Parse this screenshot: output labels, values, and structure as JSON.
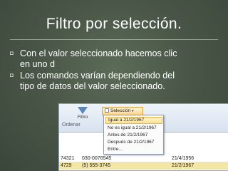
{
  "slide": {
    "title": "Filtro por selección.",
    "bullet_glyph": "◘",
    "bullets": [
      {
        "line1": "Con el valor seleccionado  hacemos clic",
        "line2": "en uno d"
      },
      {
        "line1": "Los comandos varían dependiendo del",
        "line2": "tipo de datos del valor seleccionado."
      }
    ]
  },
  "screenshot": {
    "ribbon": {
      "filtro_label": "Filtro",
      "group_label": "Ordenar",
      "seleccion_label": "Selección",
      "seleccion_arrow": "▾"
    },
    "menu_items": [
      {
        "label": "Igual a 21/2/1967",
        "active": true
      },
      {
        "label": "No es igual a 21/2/1967",
        "active": false
      },
      {
        "label": "Antes de 21/2/1967",
        "active": false
      },
      {
        "label": "Después de 21/2/1967",
        "active": false
      },
      {
        "label": "Entre...",
        "active": false
      }
    ],
    "rows": [
      {
        "a": "74321",
        "b": "030-0076545",
        "c": "21/4/1956"
      },
      {
        "a": "4729",
        "b": "(5) 555-3745",
        "c": "21/2/1967",
        "selected": true
      }
    ]
  },
  "colors": {
    "background": "#4a5748",
    "title": "#ffffff",
    "menu_highlight": "#ffe08f"
  }
}
